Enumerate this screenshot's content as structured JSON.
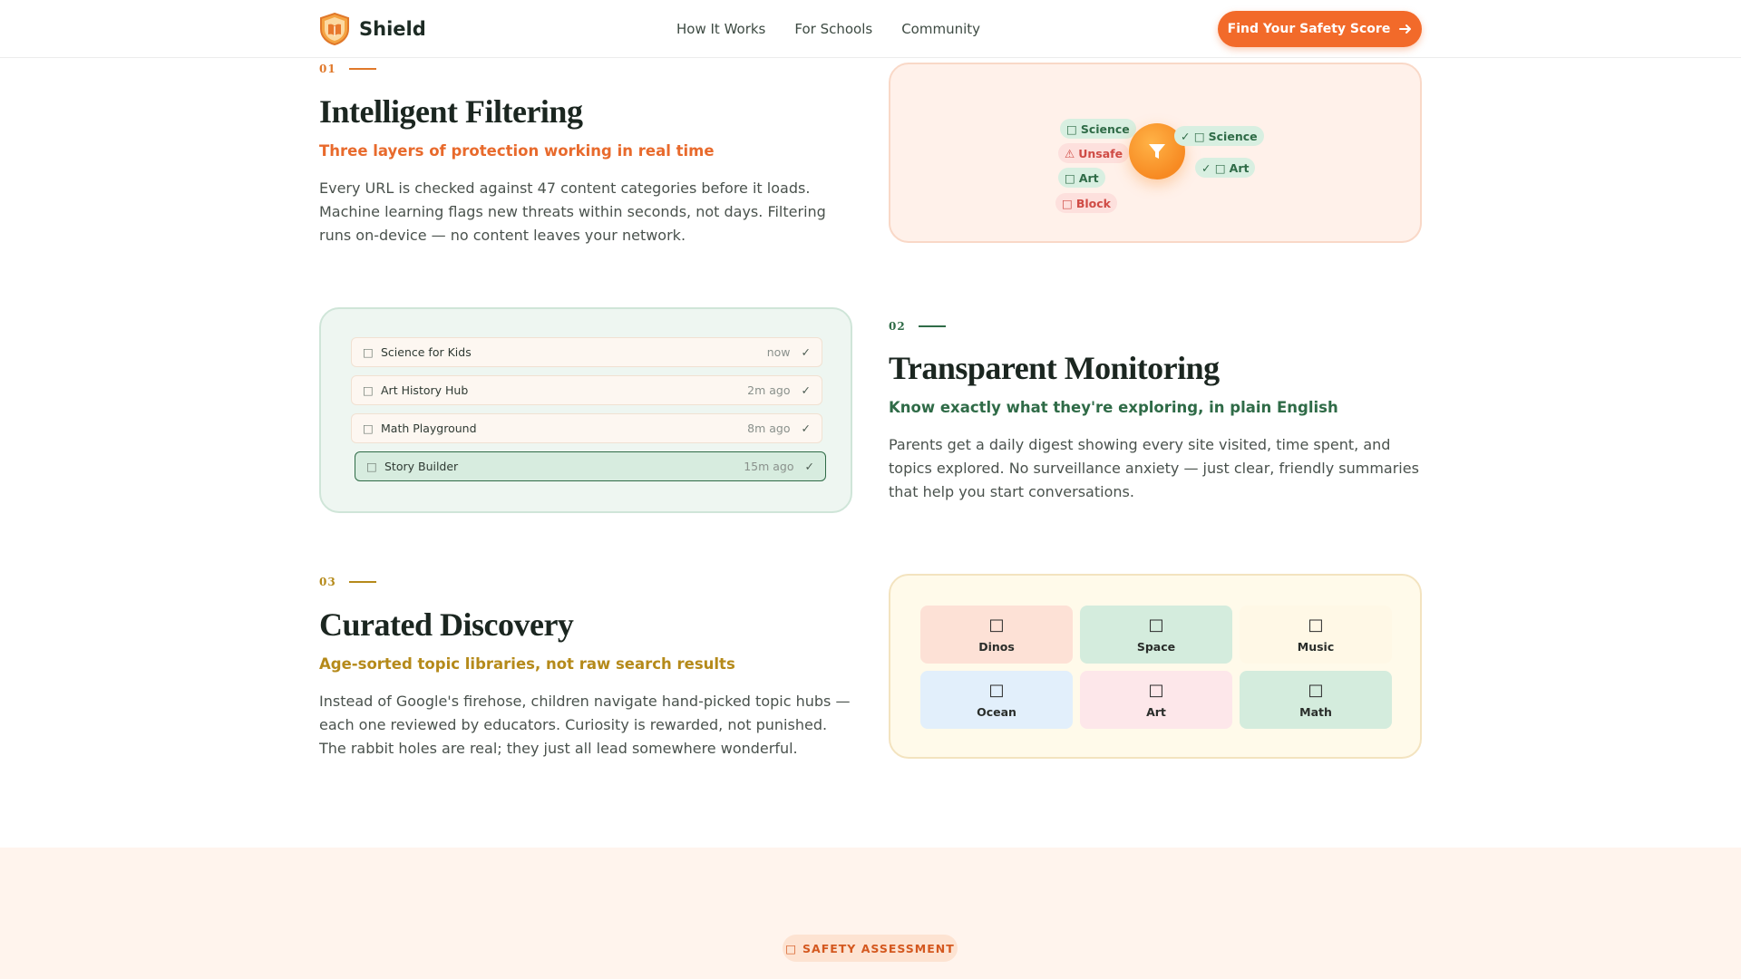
{
  "nav": {
    "brand": "Shield",
    "links": [
      "How It Works",
      "For Schools",
      "Community"
    ],
    "cta": "Find Your Safety Score"
  },
  "features": [
    {
      "number": "01",
      "title": "Intelligent Filtering",
      "subtitle": "Three layers of protection working in real time",
      "body": "Every URL is checked against 47 content categories before it loads. Machine learning flags new threats within seconds, not days. Filtering runs on-device — no content leaves your network."
    },
    {
      "number": "02",
      "title": "Transparent Monitoring",
      "subtitle": "Know exactly what they're exploring, in plain English",
      "body": "Parents get a daily digest showing every site visited, time spent, and topics explored. No surveillance anxiety — just clear, friendly summaries that help you start conversations."
    },
    {
      "number": "03",
      "title": "Curated Discovery",
      "subtitle": "Age-sorted topic libraries, not raw search results",
      "body": "Instead of Google's firehose, children navigate hand-picked topic hubs — each one reviewed by educators. Curiosity is rewarded, not punished. The rabbit holes are real; they just all lead somewhere wonderful."
    }
  ],
  "filter_card": {
    "inputs": [
      {
        "label": "Science",
        "icon": "□",
        "kind": "green"
      },
      {
        "label": "Unsafe",
        "icon": "⚠",
        "kind": "red"
      },
      {
        "label": "Art",
        "icon": "□",
        "kind": "green"
      },
      {
        "label": "Block",
        "icon": "□",
        "kind": "red"
      }
    ],
    "outputs": [
      {
        "label": "Science",
        "icon": "✓ □"
      },
      {
        "label": "Art",
        "icon": "✓ □"
      }
    ]
  },
  "activity": [
    {
      "name": "Science for Kids",
      "time": "now",
      "check": "✓"
    },
    {
      "name": "Art History Hub",
      "time": "2m ago",
      "check": "✓"
    },
    {
      "name": "Math Playground",
      "time": "8m ago",
      "check": "✓"
    },
    {
      "name": "Story Builder",
      "time": "15m ago",
      "check": "✓"
    }
  ],
  "topics": [
    {
      "label": "Dinos",
      "icon": "□",
      "color": "#fde1d6"
    },
    {
      "label": "Space",
      "icon": "□",
      "color": "#d4ecdd"
    },
    {
      "label": "Music",
      "icon": "□",
      "color": "#fff8e6"
    },
    {
      "label": "Ocean",
      "icon": "□",
      "color": "#e2effb"
    },
    {
      "label": "Art",
      "icon": "□",
      "color": "#fde7ea"
    },
    {
      "label": "Math",
      "icon": "□",
      "color": "#d4ecdd"
    }
  ],
  "assessment": {
    "badge": "SAFETY ASSESSMENT",
    "icon": "□"
  },
  "colors": {
    "accent_orange": "#f26a2a",
    "accent_green": "#2f6b47",
    "accent_gold": "#b58a1a"
  }
}
